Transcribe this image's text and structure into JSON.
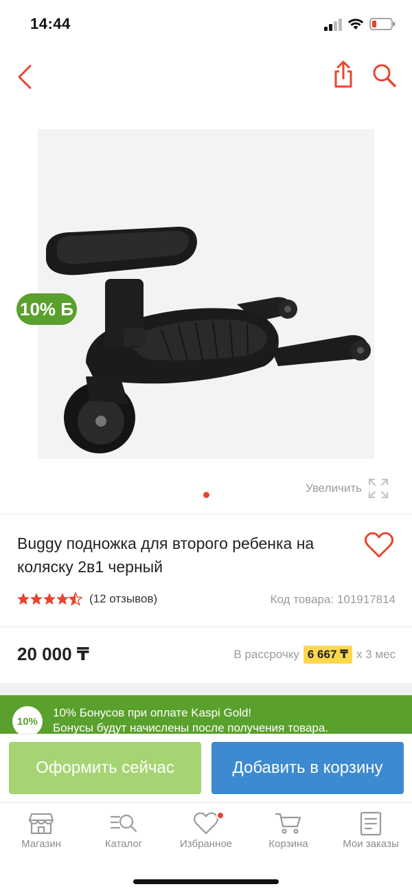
{
  "status_bar": {
    "time": "14:44"
  },
  "colors": {
    "accent": "#e8452c",
    "bonus_green": "#5aa02c",
    "buy_green": "#a6d473",
    "cart_blue": "#3d8ad0",
    "installment_yellow": "#ffd84a"
  },
  "nav": {
    "back_icon": "chevron-left-icon",
    "share_icon": "share-icon",
    "search_icon": "search-icon"
  },
  "gallery": {
    "bonus_badge": "10% Б",
    "enlarge_label": "Увеличить",
    "enlarge_icon": "expand-icon",
    "image_count": 1,
    "current_image": 1
  },
  "product": {
    "title": "Buggy подножка для второго ребенка на коляску 2в1 черный",
    "rating": 4.5,
    "rating_max": 5,
    "reviews": "(12 отзывов)",
    "sku": "Код товара: 101917814",
    "price": "20 000 ₸",
    "installment": {
      "prefix": "В рассрочку",
      "amount": "6 667 ₸",
      "suffix": "x 3 мес"
    }
  },
  "promo": {
    "badge": "10%",
    "line1": "10% Бонусов при оплате Kaspi Gold!",
    "line2": "Бонусы будут начислены после получения товара."
  },
  "actions": {
    "buy_now": "Оформить сейчас",
    "add_to_cart": "Добавить в корзину"
  },
  "tabs": [
    {
      "label": "Магазин",
      "icon": "store-icon"
    },
    {
      "label": "Каталог",
      "icon": "catalog-icon"
    },
    {
      "label": "Избранное",
      "icon": "heart-icon",
      "has_badge": true
    },
    {
      "label": "Корзина",
      "icon": "cart-icon"
    },
    {
      "label": "Мои заказы",
      "icon": "orders-icon"
    }
  ]
}
